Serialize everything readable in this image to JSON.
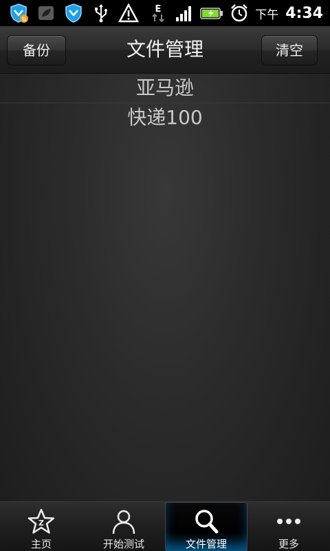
{
  "status_bar": {
    "icons": [
      "shield-sync-icon",
      "leaf-icon",
      "shield-icon",
      "usb-icon",
      "warning-icon",
      "data-e-icon",
      "signal-icon",
      "battery-icon",
      "alarm-icon"
    ],
    "network": "E",
    "time_prefix": "下午",
    "time": "4:34"
  },
  "header": {
    "title": "文件管理",
    "left_button": "备份",
    "right_button": "清空"
  },
  "list": {
    "items": [
      "亚马逊",
      "快递100"
    ]
  },
  "tabs": [
    {
      "label": "主页",
      "icon": "star-icon",
      "active": false
    },
    {
      "label": "开始测试",
      "icon": "person-icon",
      "active": false
    },
    {
      "label": "文件管理",
      "icon": "search-icon",
      "active": true
    },
    {
      "label": "更多",
      "icon": "more-icon",
      "active": false
    }
  ],
  "colors": {
    "active_tab_glow": "#0a8ad8",
    "battery": "#7fdc2c"
  }
}
